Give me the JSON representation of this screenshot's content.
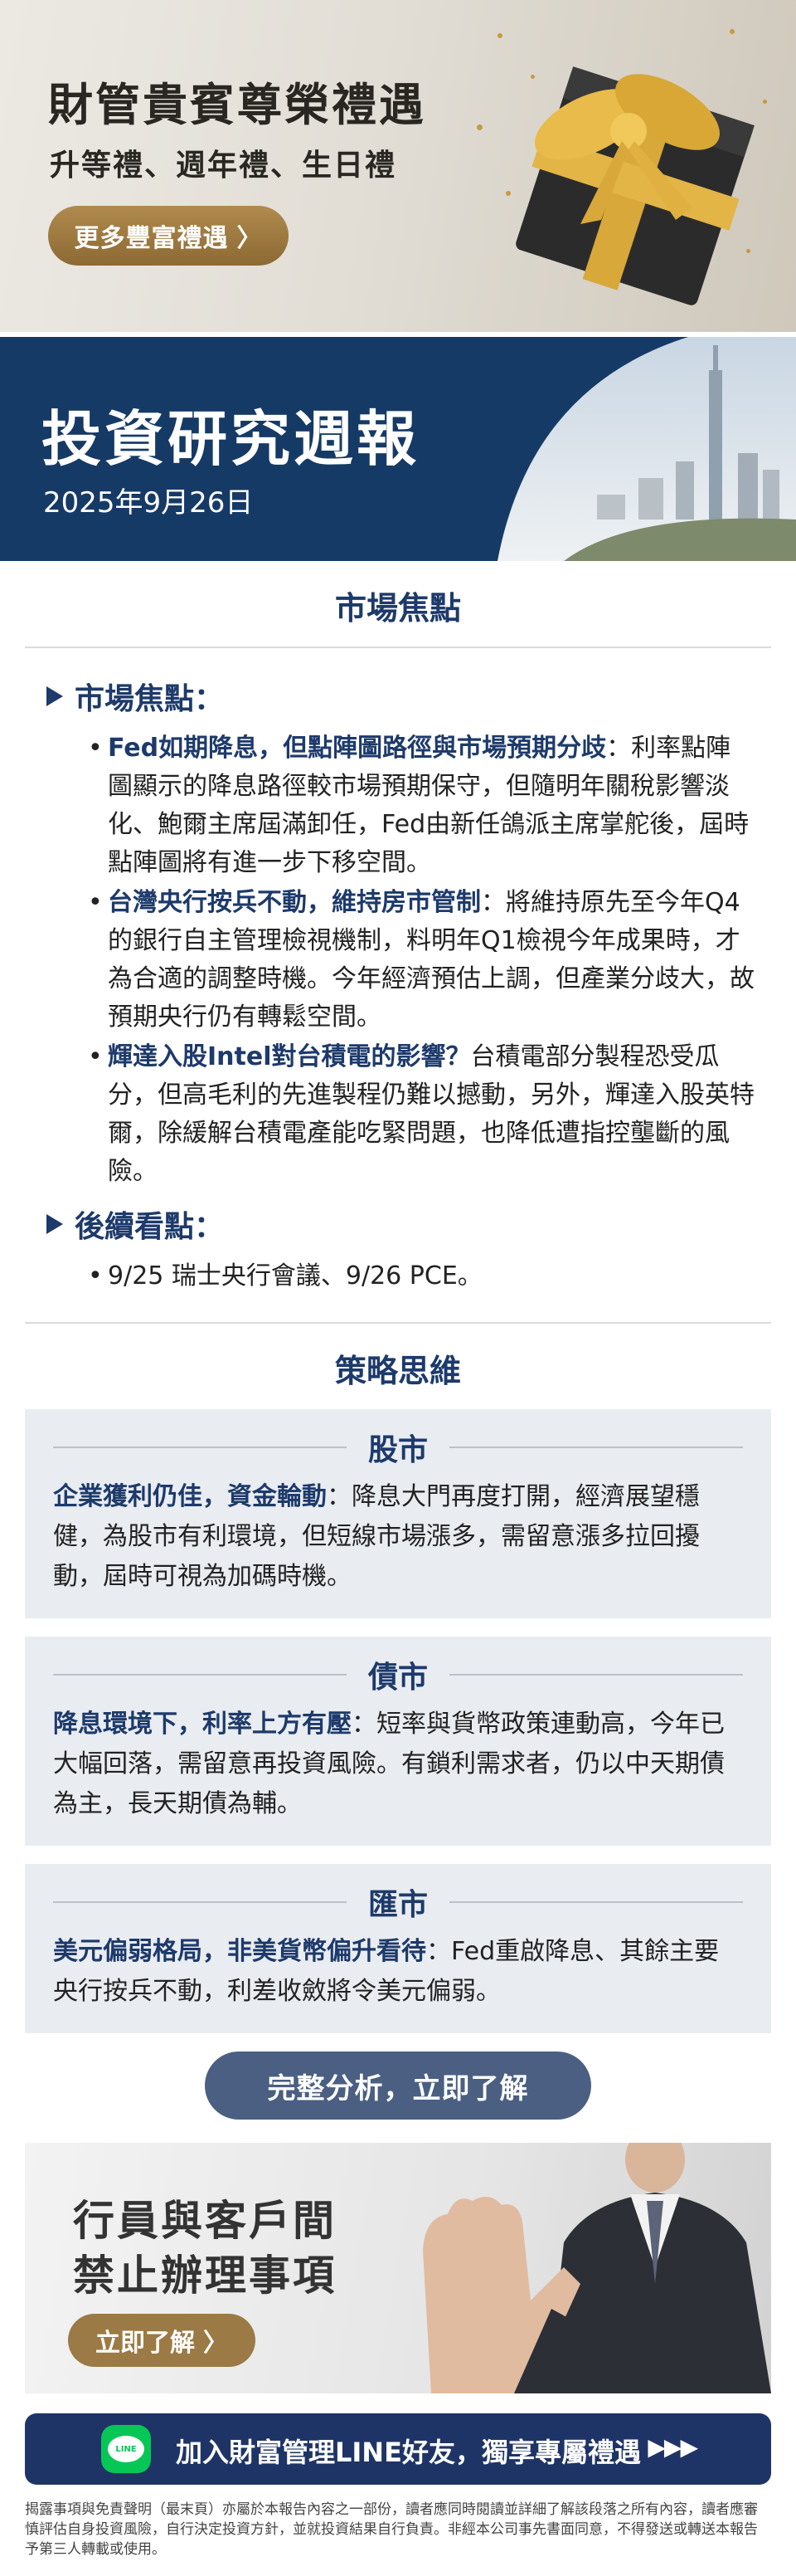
{
  "banner_vip": {
    "title": "財管貴賓尊榮禮遇",
    "subtitle": "升等禮、週年禮、生日禮",
    "button": "更多豐富禮遇",
    "button_icon": "chevron-right-icon"
  },
  "report": {
    "title": "投資研究週報",
    "date": "2025年9月26日"
  },
  "market_focus": {
    "section_title": "市場焦點",
    "head_focus": "市場焦點：",
    "bullets": [
      {
        "hl": "Fed如期降息，但點陣圖路徑與市場預期分歧",
        "text": "：利率點陣圖顯示的降息路徑較市場預期保守，但隨明年關稅影響淡化、鮑爾主席屆滿卸任，Fed由新任鴿派主席掌舵後，屆時點陣圖將有進一步下移空間。"
      },
      {
        "hl": "台灣央行按兵不動，維持房市管制",
        "text": "：將維持原先至今年Q4的銀行自主管理檢視機制，料明年Q1檢視今年成果時，才為合適的調整時機。今年經濟預估上調，但產業分歧大，故預期央行仍有轉鬆空間。"
      },
      {
        "hl": "輝達入股Intel對台積電的影響？",
        "text": "台積電部分製程恐受瓜分，但高毛利的先進製程仍難以撼動，另外，輝達入股英特爾，除緩解台積電產能吃緊問題，也降低遭指控壟斷的風險。"
      }
    ],
    "head_followup": "後續看點：",
    "followup": "9/25 瑞士央行會議、9/26 PCE。"
  },
  "strategy": {
    "section_title": "策略思維",
    "cards": [
      {
        "label": "股市",
        "hl": "企業獲利仍佳，資金輪動",
        "text": "：降息大門再度打開，經濟展望穩健，為股市有利環境，但短線市場漲多，需留意漲多拉回擾動，屆時可視為加碼時機。"
      },
      {
        "label": "債市",
        "hl": "降息環境下，利率上方有壓",
        "text": "：短率與貨幣政策連動高，今年已大幅回落，需留意再投資風險。有鎖利需求者，仍以中天期債為主，長天期債為輔。"
      },
      {
        "label": "匯市",
        "hl": "美元偏弱格局，非美貨幣偏升看待",
        "text": "：Fed重啟降息、其餘主要央行按兵不動，利差收斂將令美元偏弱。"
      }
    ],
    "cta": "完整分析，立即了解"
  },
  "banner_notice": {
    "line1": "行員與客戶間",
    "line2": "禁止辦理事項",
    "button": "立即了解",
    "button_icon": "chevron-right-icon"
  },
  "line_bar": {
    "icon": "line-app-icon",
    "icon_text": "LINE",
    "text": "加入財富管理LINE好友，獨享專屬禮遇",
    "arrows": "▶▶▶"
  },
  "disclaimer": "揭露事項與免責聲明（最末頁）亦屬於本報告內容之一部份，讀者應同時閱讀並詳細了解該段落之所有內容，讀者應審慎評估自身投資風險，自行決定投資方針，並就投資結果自行負責。非經本公司事先書面同意，不得發送或轉送本報告予第三人轉載或使用。",
  "colors": {
    "navy": "#1d3a6b",
    "gold": "#b08a4e",
    "line_green": "#06c755"
  }
}
